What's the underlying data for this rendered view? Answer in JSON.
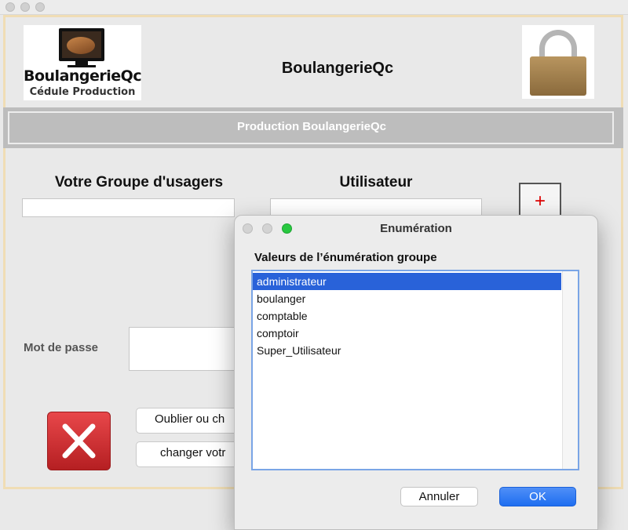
{
  "window": {
    "title_bar": ""
  },
  "logo": {
    "title": "BoulangerieQc",
    "subtitle": "Cédule Production"
  },
  "header": {
    "title": "BoulangerieQc"
  },
  "banner": {
    "text": "Production BoulangerieQc"
  },
  "form": {
    "group_label": "Votre Groupe d'usagers",
    "group_value": "",
    "user_label": "Utilisateur",
    "user_value": "",
    "add_symbol": "+",
    "password_label": "Mot de passe",
    "password_value": "",
    "forgot_button": "Oublier ou ch",
    "change_button": "changer votr"
  },
  "dialog": {
    "title": "Enumération",
    "label": "Valeurs de l’énumération groupe",
    "items": [
      "administrateur",
      "boulanger",
      "comptable",
      "comptoir",
      "Super_Utilisateur"
    ],
    "selected": "administrateur",
    "cancel_label": "Annuler",
    "ok_label": "OK"
  },
  "colors": {
    "selection": "#2962d9",
    "ok_button": "#2a72f0",
    "close_red": "#ff5f57",
    "zoom_green": "#28c840",
    "cancel_x": "#d0282b"
  }
}
